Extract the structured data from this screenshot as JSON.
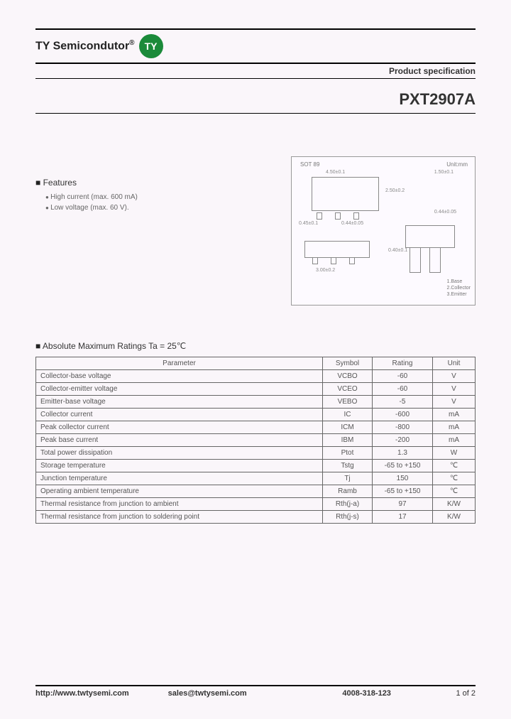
{
  "brand": {
    "name": "TY Semicondutor",
    "reg": "®",
    "logo_text": "TY"
  },
  "header": {
    "product_spec": "Product specification",
    "part_number": "PXT2907A"
  },
  "features": {
    "title": "Features",
    "items": [
      "High current (max. 600 mA)",
      "Low voltage (max. 60 V)."
    ]
  },
  "diagram": {
    "package": "SOT 89",
    "unit": "Unit:mm",
    "pins": [
      "1.Base",
      "2.Collector",
      "3.Emitter"
    ],
    "dims": [
      "4.50±0.1",
      "2.50±0.2",
      "1.50±0.1",
      "0.45±0.1",
      "0.44±0.05",
      "3.00±0.2",
      "1.50±0.1",
      "0.40±0.1"
    ]
  },
  "ratings": {
    "title": "Absolute Maximum Ratings Ta = 25℃",
    "headers": [
      "Parameter",
      "Symbol",
      "Rating",
      "Unit"
    ],
    "rows": [
      {
        "param": "Collector-base voltage",
        "symbol": "VCBO",
        "rating": "-60",
        "unit": "V"
      },
      {
        "param": "Collector-emitter voltage",
        "symbol": "VCEO",
        "rating": "-60",
        "unit": "V"
      },
      {
        "param": "Emitter-base voltage",
        "symbol": "VEBO",
        "rating": "-5",
        "unit": "V"
      },
      {
        "param": "Collector current",
        "symbol": "IC",
        "rating": "-600",
        "unit": "mA"
      },
      {
        "param": "Peak collector current",
        "symbol": "ICM",
        "rating": "-800",
        "unit": "mA"
      },
      {
        "param": "Peak base current",
        "symbol": "IBM",
        "rating": "-200",
        "unit": "mA"
      },
      {
        "param": "Total power dissipation",
        "symbol": "Ptot",
        "rating": "1.3",
        "unit": "W"
      },
      {
        "param": "Storage temperature",
        "symbol": "Tstg",
        "rating": "-65 to +150",
        "unit": "℃"
      },
      {
        "param": "Junction temperature",
        "symbol": "Tj",
        "rating": "150",
        "unit": "℃"
      },
      {
        "param": "Operating ambient temperature",
        "symbol": "Ramb",
        "rating": "-65 to +150",
        "unit": "℃"
      },
      {
        "param": "Thermal resistance from junction to ambient",
        "symbol": "Rth(j-a)",
        "rating": "97",
        "unit": "K/W"
      },
      {
        "param": "Thermal resistance from junction to soldering point",
        "symbol": "Rth(j-s)",
        "rating": "17",
        "unit": "K/W"
      }
    ]
  },
  "footer": {
    "url": "http://www.twtysemi.com",
    "email": "sales@twtysemi.com",
    "phone": "4008-318-123",
    "page": "1 of 2"
  }
}
